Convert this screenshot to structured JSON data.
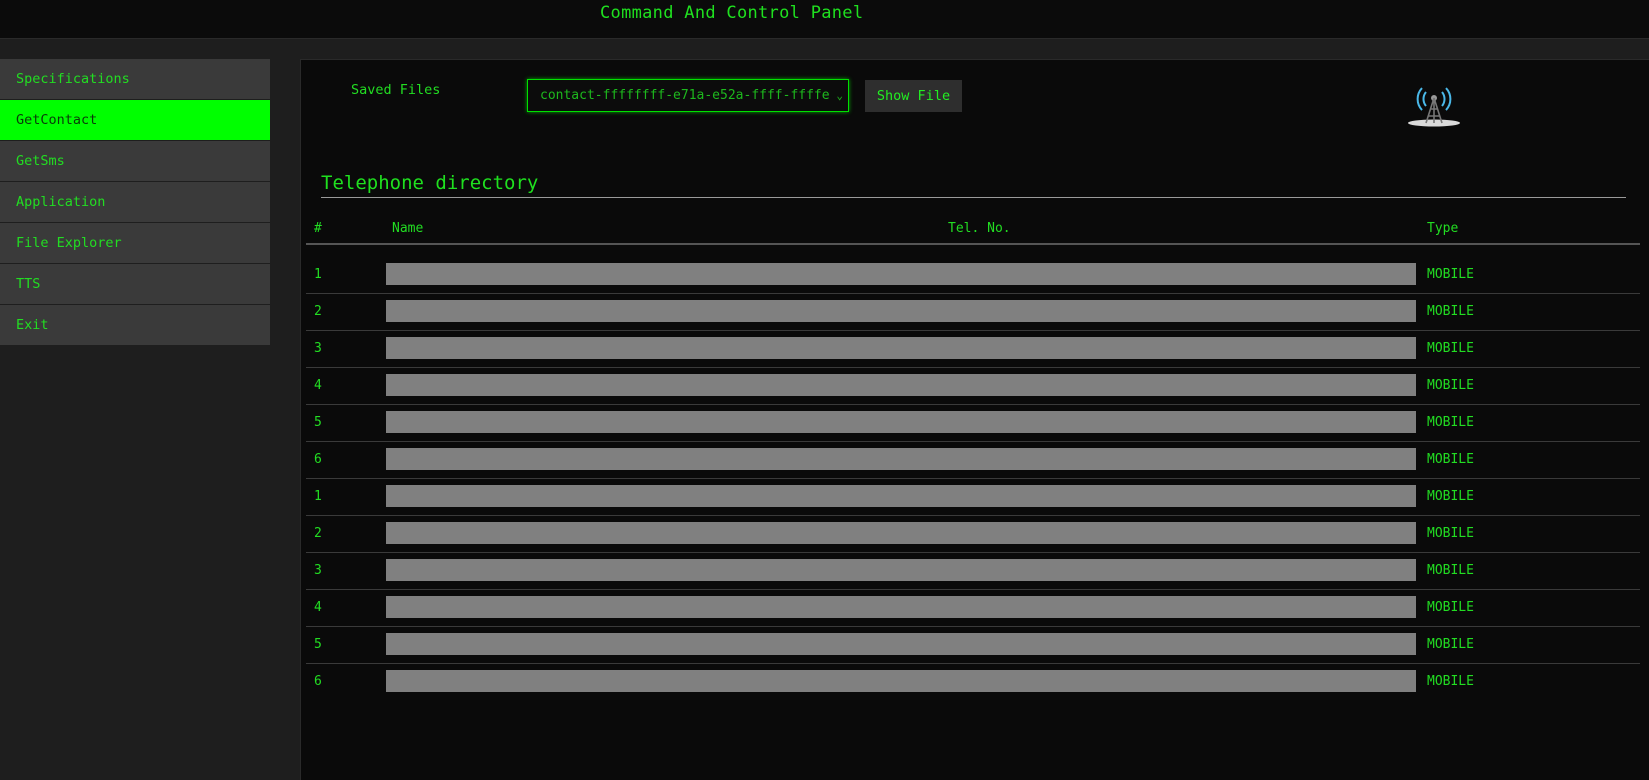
{
  "app": {
    "title": "Command And Control Panel"
  },
  "sidebar": {
    "items": [
      {
        "label": "Specifications",
        "active": false
      },
      {
        "label": "GetContact",
        "active": true
      },
      {
        "label": "GetSms",
        "active": false
      },
      {
        "label": "Application",
        "active": false
      },
      {
        "label": "File Explorer",
        "active": false
      },
      {
        "label": "TTS",
        "active": false
      },
      {
        "label": "Exit",
        "active": false
      }
    ]
  },
  "main": {
    "saved_files_label": "Saved Files",
    "file_select_value": "contact-ffffffff-e71a-e52a-ffff-ffffe",
    "show_file_label": "Show File",
    "tower_icon": "radio-tower-icon",
    "section_title": "Telephone directory",
    "table": {
      "headers": {
        "num": "#",
        "name": "Name",
        "tel": "Tel. No.",
        "type": "Type"
      },
      "rows": [
        {
          "num": "1",
          "type": "MOBILE"
        },
        {
          "num": "2",
          "type": "MOBILE"
        },
        {
          "num": "3",
          "type": "MOBILE"
        },
        {
          "num": "4",
          "type": "MOBILE"
        },
        {
          "num": "5",
          "type": "MOBILE"
        },
        {
          "num": "6",
          "type": "MOBILE"
        },
        {
          "num": "1",
          "type": "MOBILE"
        },
        {
          "num": "2",
          "type": "MOBILE"
        },
        {
          "num": "3",
          "type": "MOBILE"
        },
        {
          "num": "4",
          "type": "MOBILE"
        },
        {
          "num": "5",
          "type": "MOBILE"
        },
        {
          "num": "6",
          "type": "MOBILE"
        }
      ]
    }
  },
  "colors": {
    "accent": "#00ff00",
    "text": "#1ad31a",
    "redaction": "#808080"
  }
}
